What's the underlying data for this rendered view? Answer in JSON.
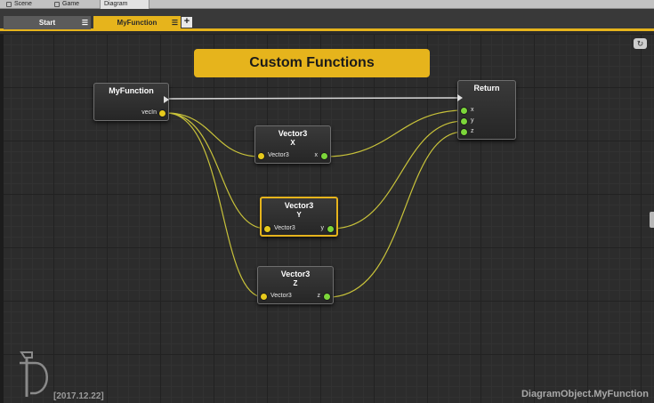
{
  "editor_tabs": [
    {
      "label": "Scene",
      "icon": "scene-icon"
    },
    {
      "label": "Game",
      "icon": "game-icon"
    },
    {
      "label": "Diagram",
      "icon": ""
    }
  ],
  "diagram_tabs": [
    {
      "label": "Start",
      "active": false
    },
    {
      "label": "MyFunction",
      "active": true
    }
  ],
  "add_tab_label": "+",
  "tab_menu_glyph": "☰",
  "refresh_glyph": "↻",
  "banner": "Custom Functions",
  "nodes": {
    "myfunction": {
      "title": "MyFunction",
      "out_port": "vecIn"
    },
    "return": {
      "title": "Return",
      "ports": [
        "x",
        "y",
        "z"
      ]
    },
    "vector_x": {
      "title": "Vector3",
      "subtitle": "X",
      "in_port": "Vector3",
      "out_port": "x"
    },
    "vector_y": {
      "title": "Vector3",
      "subtitle": "Y",
      "in_port": "Vector3",
      "out_port": "y"
    },
    "vector_z": {
      "title": "Vector3",
      "subtitle": "Z",
      "in_port": "Vector3",
      "out_port": "z"
    }
  },
  "footer": {
    "date": "[2017.12.22]",
    "object_path": "DiagramObject.MyFunction"
  },
  "colors": {
    "accent": "#e6b41c",
    "wire": "#c8c23a",
    "port_in": "#e6c91c",
    "port_out": "#7cd63a",
    "canvas": "#2c2c2c"
  }
}
